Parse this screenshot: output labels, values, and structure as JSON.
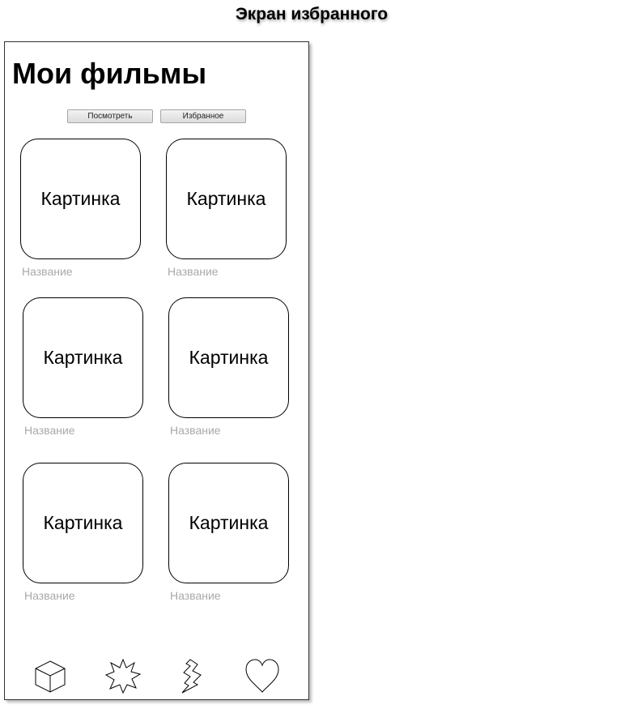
{
  "screen_title": "Экран избранного",
  "page_title": "Мои фильмы",
  "tabs": [
    {
      "label": "Посмотреть"
    },
    {
      "label": "Избранное"
    }
  ],
  "movies": [
    {
      "image_label": "Картинка",
      "name": "Название"
    },
    {
      "image_label": "Картинка",
      "name": "Название"
    },
    {
      "image_label": "Картинка",
      "name": "Название"
    },
    {
      "image_label": "Картинка",
      "name": "Название"
    },
    {
      "image_label": "Картинка",
      "name": "Название"
    },
    {
      "image_label": "Картинка",
      "name": "Название"
    }
  ],
  "bottom_nav": {
    "icons": [
      "cube-icon",
      "starburst-icon",
      "lightning-icon",
      "heart-icon"
    ]
  }
}
